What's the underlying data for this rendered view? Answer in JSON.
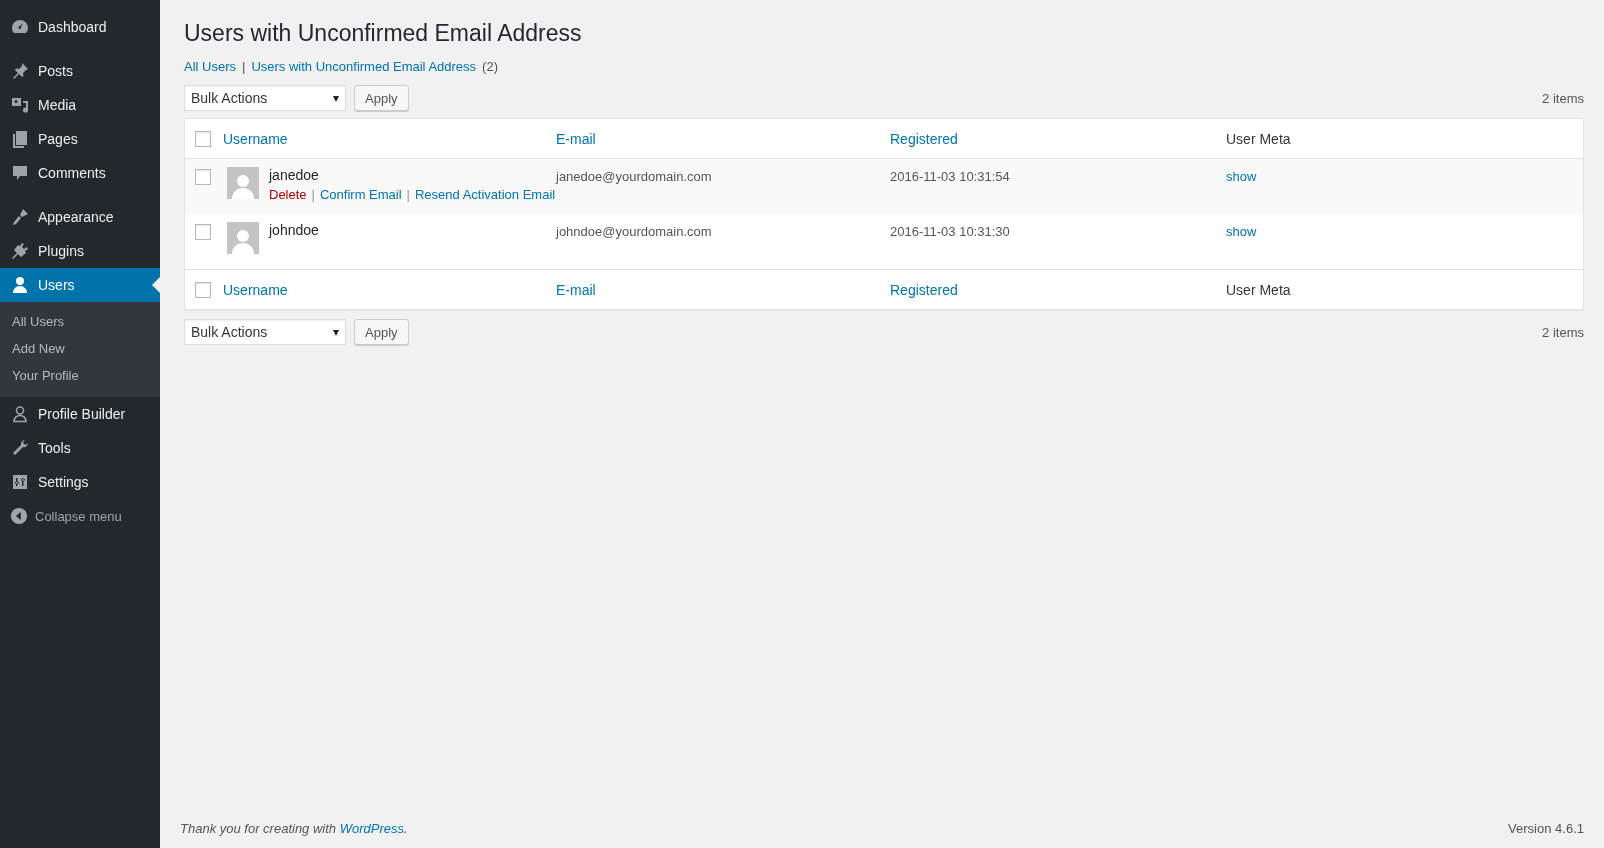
{
  "sidebar": {
    "groups": [
      [
        {
          "label": "Dashboard",
          "selected": false
        }
      ],
      [
        {
          "label": "Posts",
          "selected": false
        },
        {
          "label": "Media",
          "selected": false
        },
        {
          "label": "Pages",
          "selected": false
        },
        {
          "label": "Comments",
          "selected": false
        }
      ],
      [
        {
          "label": "Appearance",
          "selected": false
        },
        {
          "label": "Plugins",
          "selected": false
        },
        {
          "label": "Users",
          "selected": true,
          "children": [
            {
              "label": "All Users"
            },
            {
              "label": "Add New"
            },
            {
              "label": "Your Profile"
            }
          ]
        },
        {
          "label": "Profile Builder",
          "selected": false
        },
        {
          "label": "Tools",
          "selected": false
        },
        {
          "label": "Settings",
          "selected": false
        }
      ]
    ],
    "collapse": "Collapse menu"
  },
  "page": {
    "title": "Users with Unconfirmed Email Address",
    "views": [
      {
        "label": "All Users"
      },
      {
        "separator": "|",
        "label": "Users with Unconfirmed Email Address",
        "count": "(2)"
      }
    ],
    "bulk_top": {
      "select": "Bulk Actions",
      "button": "Apply",
      "count": "2 items"
    },
    "table": {
      "columns": [
        {
          "label": "Username",
          "sortable": true
        },
        {
          "label": "E-mail",
          "sortable": true
        },
        {
          "label": "Registered",
          "sortable": true
        },
        {
          "label": "User Meta",
          "sortable": false
        }
      ],
      "footer_columns": [
        {
          "label": "Username",
          "sortable": true
        },
        {
          "label": "E-mail",
          "sortable": true
        },
        {
          "label": "Registered",
          "sortable": true
        },
        {
          "label": "User Meta",
          "sortable": false
        }
      ],
      "header_checked": false,
      "rows": [
        {
          "checked": false,
          "username": "janedoe",
          "actions": [
            {
              "label": "Delete",
              "kind": "danger"
            },
            {
              "separator": "|",
              "label": "Confirm Email",
              "kind": "link"
            },
            {
              "separator": "|",
              "label": "Resend Activation Email",
              "kind": "link"
            }
          ],
          "email": "janedoe@yourdomain.com",
          "registered": "2016-11-03 10:31:54",
          "meta": "show"
        },
        {
          "checked": false,
          "username": "johndoe",
          "actions": [],
          "email": "johndoe@yourdomain.com",
          "registered": "2016-11-03 10:31:30",
          "meta": "show"
        }
      ],
      "footer_checked": false
    },
    "bulk_bottom": {
      "select": "Bulk Actions",
      "button": "Apply",
      "count": "2 items"
    }
  },
  "footer": {
    "thanks_before": "Thank you for creating with ",
    "thanks_link": "WordPress",
    "thanks_after": ".",
    "version": "Version 4.6.1"
  }
}
